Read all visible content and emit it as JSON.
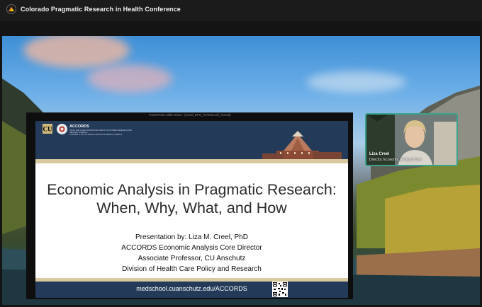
{
  "app": {
    "conference_title": "Colorado Pragmatic Research in Health Conference"
  },
  "slide": {
    "window_caption": "PowerPoint Slide Show - [Creel_EPS_CPRHConf_Nov23]",
    "header": {
      "org_name": "ACCORDS",
      "org_subtitle": "ADULT AND CHILD CENTER FOR HEALTH OUTCOMES RESEARCH AND DELIVERY SCIENCE",
      "university": "UNIVERSITY OF COLORADO ANSCHUTZ MEDICAL CAMPUS"
    },
    "title_line1": "Economic Analysis in Pragmatic Research:",
    "title_line2": "When, Why, What, and How",
    "presenter_lines": [
      "Presentation by: Liza M. Creel, PhD",
      "ACCORDS Economic Analysis Core Director",
      "Associate Professor, CU Anschutz",
      "Division of Health Care Policy and Research"
    ],
    "footer_url": "medschool.cuanschutz.edu/ACCORDS"
  },
  "speaker": {
    "name": "Liza Creel",
    "title": "Director, Economic Analysis Core"
  },
  "colors": {
    "slide_navy": "#233a58",
    "slide_tan": "#d8c9a0",
    "tile_border": "#3ba38c",
    "topbar": "#1b1b1b"
  }
}
